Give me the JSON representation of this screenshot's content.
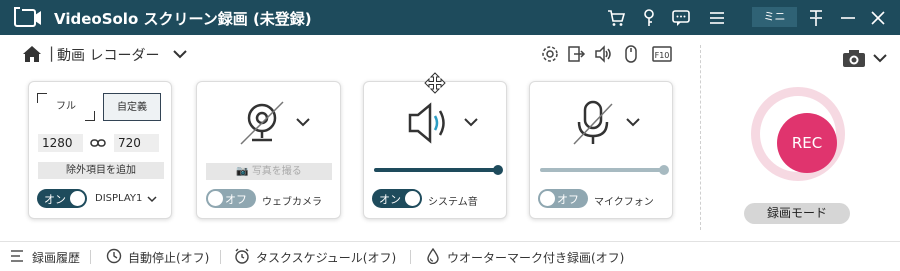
{
  "app": {
    "title": "VideoSolo スクリーン録画 (未登録)",
    "mini_label": "ミニ"
  },
  "titlebar_icons": [
    "cart-icon",
    "key-icon",
    "chat-icon",
    "menu-icon",
    "pin-icon",
    "minimize-icon",
    "close-icon"
  ],
  "toolbar": {
    "breadcrumb_sep": "|",
    "mode_label": "動画 レコーダー",
    "tools": [
      "gear-icon",
      "export-icon",
      "speaker-icon",
      "mouse-icon",
      "hotkey-icon"
    ],
    "hotkey_label": "F10"
  },
  "display_panel": {
    "full_label": "フル",
    "custom_label": "自定義",
    "width": "1280",
    "height": "720",
    "exclude_label": "除外項目を追加",
    "toggle_label": "オン",
    "toggle_state": "on",
    "display_name": "DISPLAY1"
  },
  "webcam_panel": {
    "snapshot_label": "写真を撮る",
    "toggle_label": "オフ",
    "toggle_state": "off",
    "name": "ウェブカメラ"
  },
  "system_panel": {
    "toggle_label": "オン",
    "toggle_state": "on",
    "name": "システム音",
    "volume": 1.0,
    "slider_color": "#1e4b5c"
  },
  "mic_panel": {
    "toggle_label": "オフ",
    "toggle_state": "off",
    "name": "マイクフォン",
    "volume": 1.0,
    "slider_color": "#a7bac1"
  },
  "rec": {
    "label": "REC",
    "mode_label": "録画モード",
    "color": "#e0346e"
  },
  "bottombar": {
    "history": "録画履歴",
    "auto_stop": "自動停止(オフ)",
    "schedule": "タスクスケジュール(オフ)",
    "watermark": "ウオーターマーク付き録画(オフ)"
  },
  "colors": {
    "titlebar": "#1e4b5c",
    "accent": "#1e4b5c",
    "rec": "#e0346e"
  }
}
